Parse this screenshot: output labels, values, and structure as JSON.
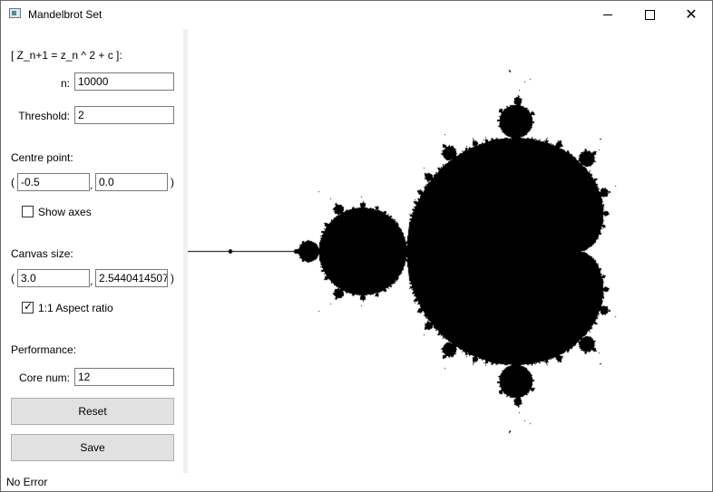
{
  "window": {
    "title": "Mandelbrot Set",
    "close_glyph": "✕",
    "icon": "app-window-icon"
  },
  "formula": {
    "label": "[ Z_n+1 = z_n ^ 2 + c ]:"
  },
  "iterations": {
    "label": "n:",
    "value": "10000"
  },
  "threshold": {
    "label": "Threshold:",
    "value": "2"
  },
  "centre": {
    "section_label": "Centre point:",
    "open_paren": "(",
    "comma": ",",
    "close_paren": ")",
    "x": "-0.5",
    "y": "0.0"
  },
  "show_axes": {
    "label": "Show axes",
    "checked": false
  },
  "canvas_size": {
    "section_label": "Canvas size:",
    "open_paren": "(",
    "comma": ",",
    "close_paren": ")",
    "width": "3.0",
    "height": "2.5440414507"
  },
  "aspect_ratio": {
    "label": "1:1 Aspect ratio",
    "checked": true,
    "check_glyph": "✓"
  },
  "performance": {
    "section_label": "Performance:",
    "cores_label": "Core num:",
    "cores": "12"
  },
  "buttons": {
    "reset": "Reset",
    "save": "Save"
  },
  "status": {
    "text": "No Error"
  },
  "render": {
    "fill_color": "#000000",
    "background_color": "#ffffff"
  }
}
